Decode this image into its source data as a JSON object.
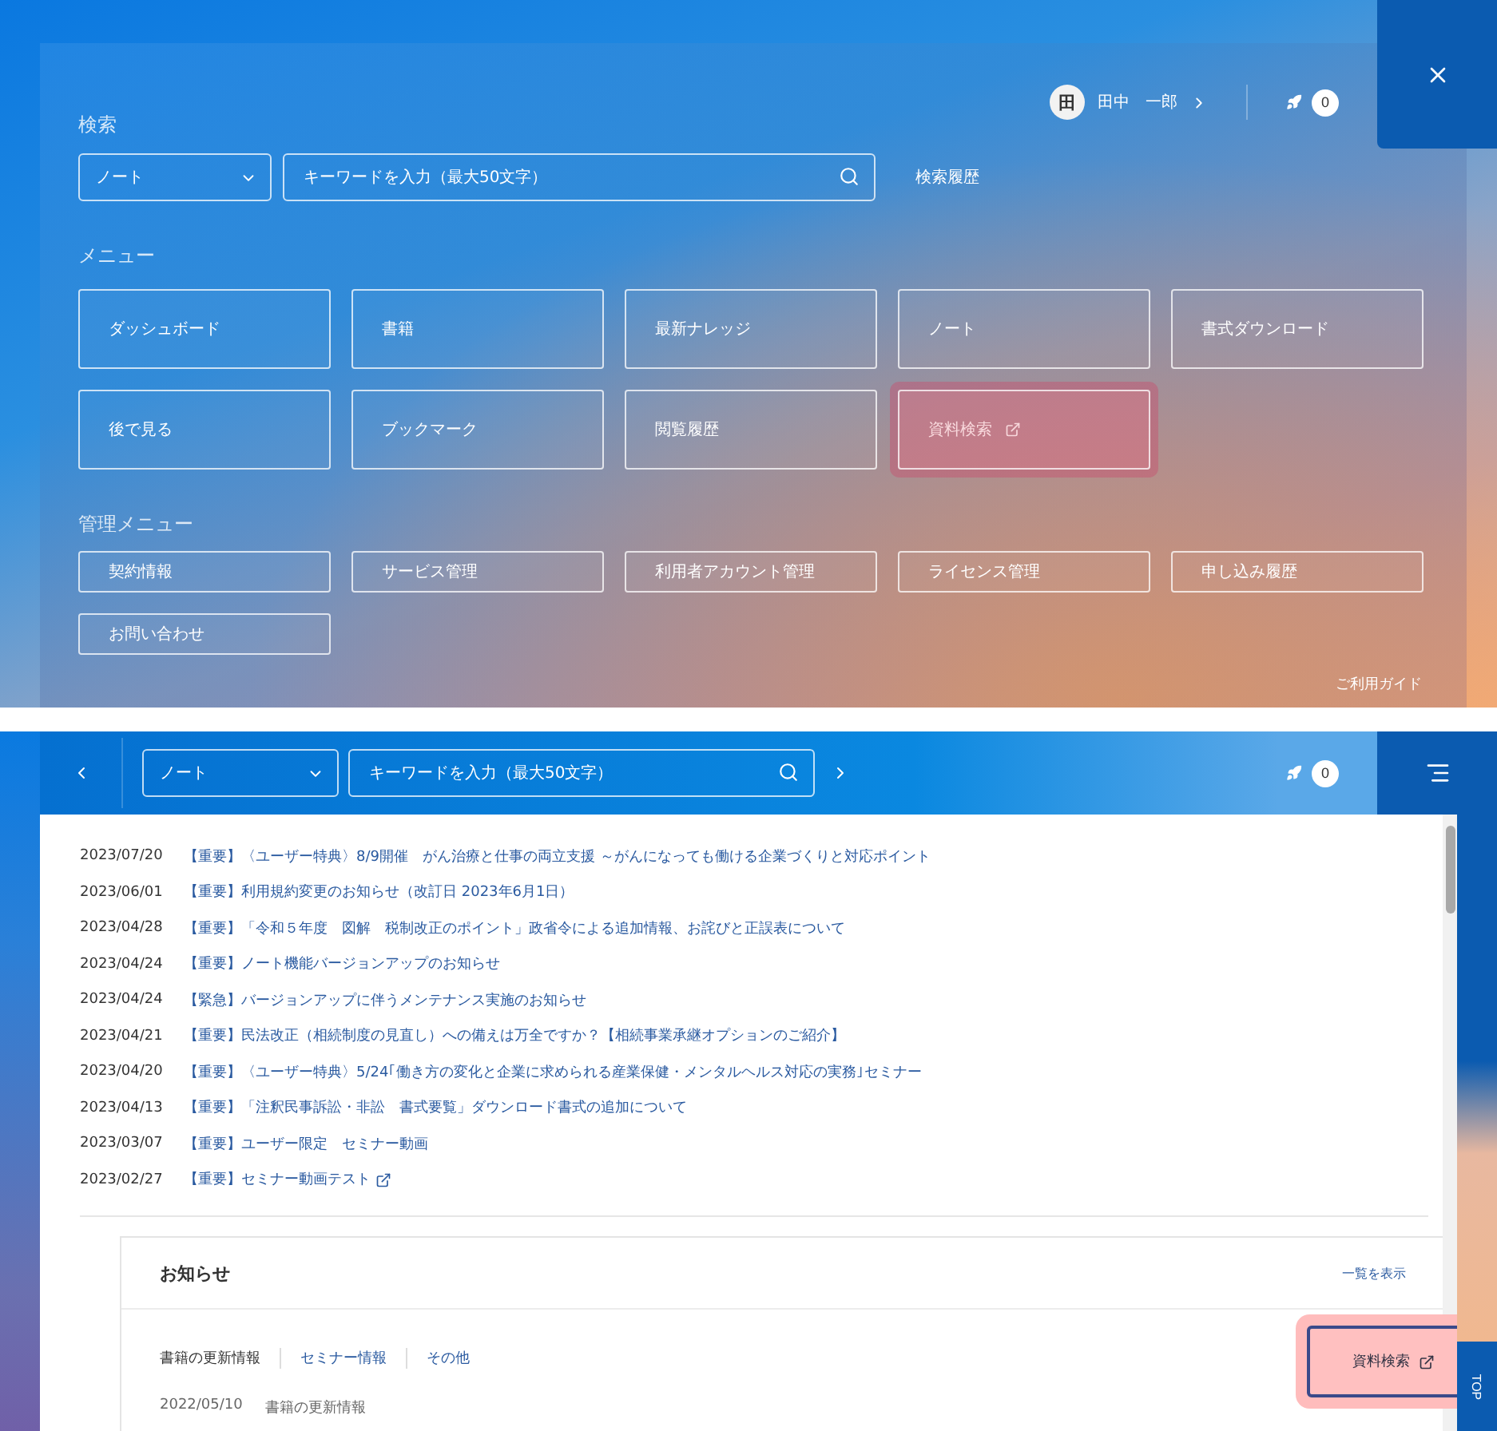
{
  "top": {
    "user": {
      "avatar": "田",
      "name": "田中　一郎"
    },
    "notification_count": "0",
    "search": {
      "title": "検索",
      "category": "ノート",
      "placeholder": "キーワードを入力（最大50文字）",
      "history_link": "検索履歴"
    },
    "menu": {
      "title": "メニュー",
      "items": [
        {
          "label": "ダッシュボード",
          "external": false,
          "highlighted": false
        },
        {
          "label": "書籍",
          "external": false,
          "highlighted": false
        },
        {
          "label": "最新ナレッジ",
          "external": false,
          "highlighted": false
        },
        {
          "label": "ノート",
          "external": false,
          "highlighted": false
        },
        {
          "label": "書式ダウンロード",
          "external": false,
          "highlighted": false
        },
        {
          "label": "後で見る",
          "external": false,
          "highlighted": false
        },
        {
          "label": "ブックマーク",
          "external": false,
          "highlighted": false
        },
        {
          "label": "閲覧履歴",
          "external": false,
          "highlighted": false
        },
        {
          "label": "資料検索",
          "external": true,
          "highlighted": true
        }
      ]
    },
    "admin_menu": {
      "title": "管理メニュー",
      "items": [
        "契約情報",
        "サービス管理",
        "利用者アカウント管理",
        "ライセンス管理",
        "申し込み履歴",
        "お問い合わせ"
      ]
    },
    "guide_link": "ご利用ガイド"
  },
  "bottom": {
    "category": "ノート",
    "placeholder": "キーワードを入力（最大50文字）",
    "notification_count": "0",
    "news": [
      {
        "date": "2023/07/20",
        "title": "【重要】〈ユーザー特典〉8/9開催　がん治療と仕事の両立支援 ～がんになっても働ける企業づくりと対応ポイント",
        "external": false
      },
      {
        "date": "2023/06/01",
        "title": "【重要】利用規約変更のお知らせ（改訂日 2023年6月1日）",
        "external": false
      },
      {
        "date": "2023/04/28",
        "title": "【重要】「令和５年度　図解　税制改正のポイント」政省令による追加情報、お詫びと正誤表について",
        "external": false
      },
      {
        "date": "2023/04/24",
        "title": "【重要】ノート機能バージョンアップのお知らせ",
        "external": false
      },
      {
        "date": "2023/04/24",
        "title": "【緊急】バージョンアップに伴うメンテナンス実施のお知らせ",
        "external": false
      },
      {
        "date": "2023/04/21",
        "title": "【重要】民法改正（相続制度の見直し）への備えは万全ですか？【相続事業承継オプションのご紹介】",
        "external": false
      },
      {
        "date": "2023/04/20",
        "title": "【重要】〈ユーザー特典〉5/24｢働き方の変化と企業に求められる産業保健・メンタルヘルス対応の実務｣セミナー",
        "external": false
      },
      {
        "date": "2023/04/13",
        "title": "【重要】「注釈民事訴訟・非訟　書式要覧」ダウンロード書式の追加について",
        "external": false
      },
      {
        "date": "2023/03/07",
        "title": "【重要】ユーザー限定　セミナー動画",
        "external": false
      },
      {
        "date": "2023/02/27",
        "title": "【重要】セミナー動画テスト",
        "external": true
      }
    ],
    "notices": {
      "title": "お知らせ",
      "view_all": "一覧を表示",
      "tabs": [
        {
          "label": "書籍の更新情報",
          "selected": true
        },
        {
          "label": "セミナー情報",
          "selected": false
        },
        {
          "label": "その他",
          "selected": false
        }
      ],
      "entries": [
        {
          "date": "2022/05/10",
          "category": "書籍の更新情報"
        }
      ]
    },
    "floating_button": {
      "label": "資料検索",
      "external": true,
      "highlighted": true
    },
    "top_button": "TOP"
  }
}
